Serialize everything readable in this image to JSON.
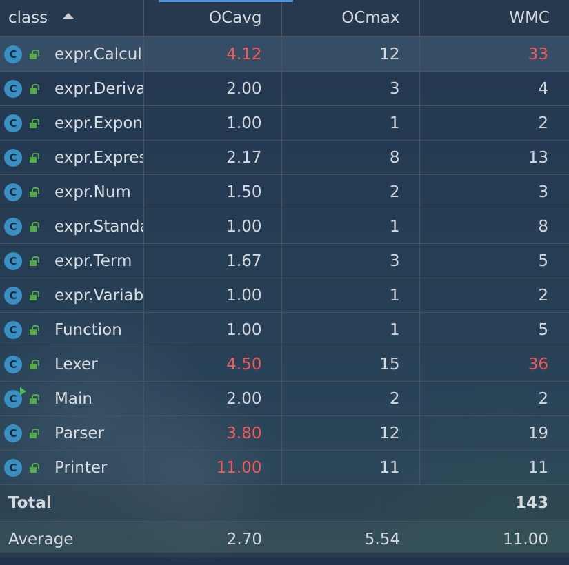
{
  "header": {
    "class_label": "class",
    "ocavg_label": "OCavg",
    "ocmax_label": "OCmax",
    "wmc_label": "WMC"
  },
  "colors": {
    "warning": "#f05a5a",
    "class_icon": "#3a8fc2",
    "lock_icon": "#55a84a",
    "accent": "#4a8fdb"
  },
  "rows": [
    {
      "name": "expr.Calcula",
      "ocavg": "4.12",
      "ocmax": "12",
      "wmc": "33",
      "ocavg_warn": true,
      "wmc_warn": true
    },
    {
      "name": "expr.Deriva",
      "ocavg": "2.00",
      "ocmax": "3",
      "wmc": "4"
    },
    {
      "name": "expr.Expone",
      "ocavg": "1.00",
      "ocmax": "1",
      "wmc": "2"
    },
    {
      "name": "expr.Expres",
      "ocavg": "2.17",
      "ocmax": "8",
      "wmc": "13"
    },
    {
      "name": "expr.Num",
      "ocavg": "1.50",
      "ocmax": "2",
      "wmc": "3"
    },
    {
      "name": "expr.Standa",
      "ocavg": "1.00",
      "ocmax": "1",
      "wmc": "8"
    },
    {
      "name": "expr.Term",
      "ocavg": "1.67",
      "ocmax": "3",
      "wmc": "5"
    },
    {
      "name": "expr.Variab",
      "ocavg": "1.00",
      "ocmax": "1",
      "wmc": "2"
    },
    {
      "name": "Function",
      "ocavg": "1.00",
      "ocmax": "1",
      "wmc": "5"
    },
    {
      "name": "Lexer",
      "ocavg": "4.50",
      "ocmax": "15",
      "wmc": "36",
      "ocavg_warn": true,
      "wmc_warn": true
    },
    {
      "name": "Main",
      "ocavg": "2.00",
      "ocmax": "2",
      "wmc": "2",
      "runnable": true
    },
    {
      "name": "Parser",
      "ocavg": "3.80",
      "ocmax": "12",
      "wmc": "19",
      "ocavg_warn": true
    },
    {
      "name": "Printer",
      "ocavg": "11.00",
      "ocmax": "11",
      "wmc": "11",
      "ocavg_warn": true
    }
  ],
  "total": {
    "label": "Total",
    "wmc": "143"
  },
  "average": {
    "label": "Average",
    "ocavg": "2.70",
    "ocmax": "5.54",
    "wmc": "11.00"
  },
  "icons": {
    "class": "class-icon",
    "lock": "lock-open-icon",
    "run": "run-icon",
    "sort": "sort-ascending-icon"
  }
}
